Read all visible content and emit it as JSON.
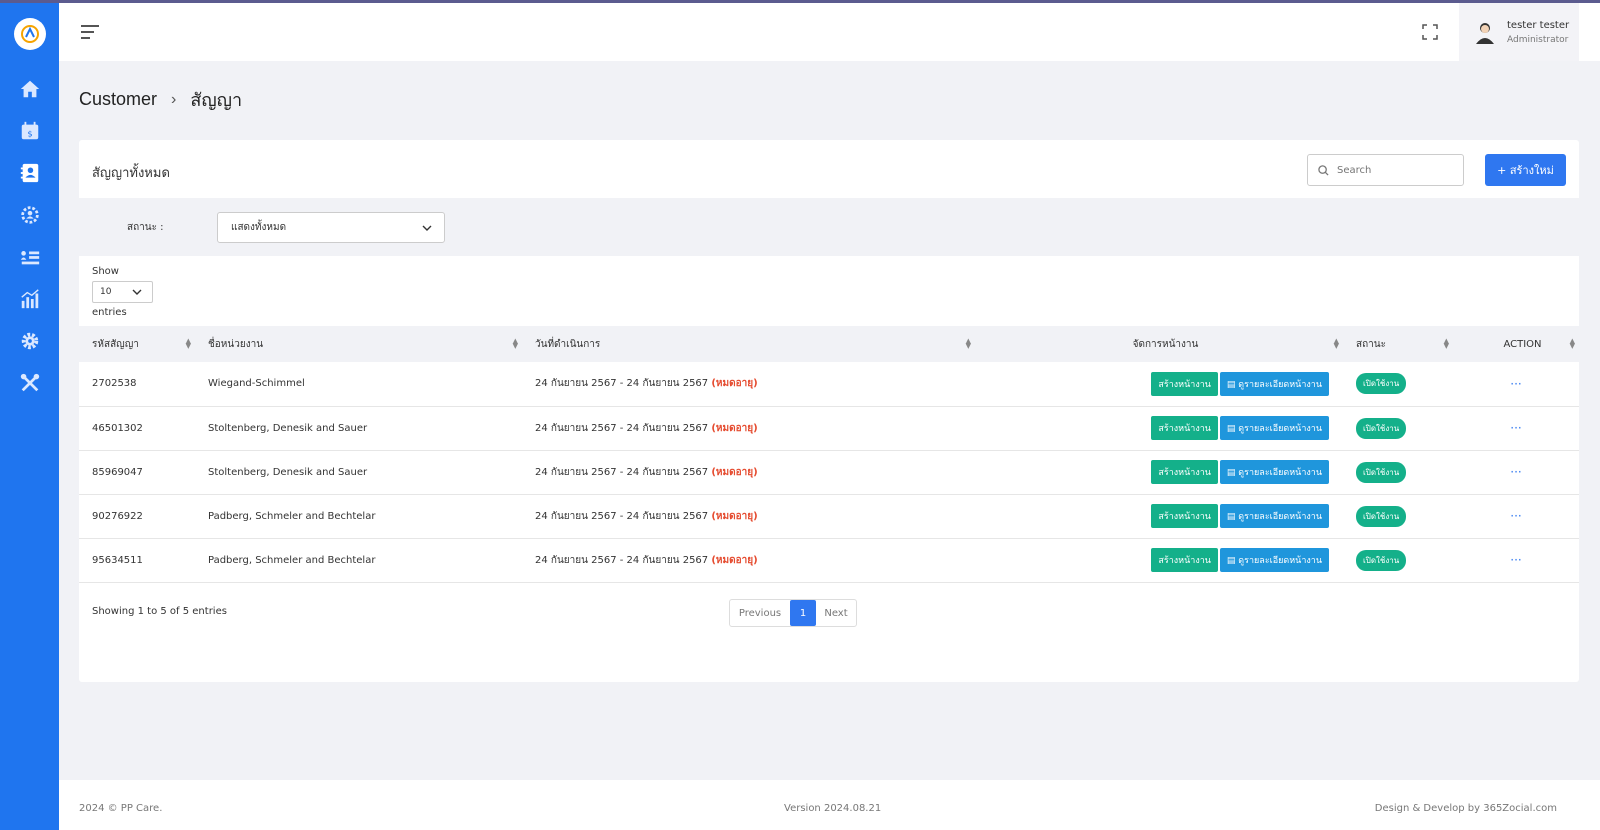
{
  "header": {
    "user_name": "tester tester",
    "user_role": "Administrator"
  },
  "breadcrumb": {
    "parent": "Customer",
    "current": "สัญญา"
  },
  "card": {
    "title": "สัญญาทั้งหมด",
    "search_placeholder": "Search",
    "create_label": "+ สร้างใหม่"
  },
  "filter": {
    "label": "สถานะ :",
    "selected": "แสดงทั้งหมด"
  },
  "length": {
    "show_label": "Show",
    "value": "10",
    "entries_label": "entries"
  },
  "table": {
    "headers": [
      "รหัสสัญญา",
      "ชื่อหน่วยงาน",
      "วันที่ดำเนินการ",
      "จัดการหน้างาน",
      "สถานะ",
      "ACTION"
    ],
    "expired_label": "(หมดอายุ)",
    "create_site_label": "สร้างหน้างาน",
    "view_site_label": "ดูรายละเอียดหน้างาน",
    "status_label": "เปิดใช้งาน",
    "more_label": "···",
    "rows": [
      {
        "id": "2702538",
        "org": "Wiegand-Schimmel",
        "date": "24 กันยายน 2567 - 24 กันยายน 2567"
      },
      {
        "id": "46501302",
        "org": "Stoltenberg, Denesik and Sauer",
        "date": "24 กันยายน 2567 - 24 กันยายน 2567"
      },
      {
        "id": "85969047",
        "org": "Stoltenberg, Denesik and Sauer",
        "date": "24 กันยายน 2567 - 24 กันยายน 2567"
      },
      {
        "id": "90276922",
        "org": "Padberg, Schmeler and Bechtelar",
        "date": "24 กันยายน 2567 - 24 กันยายน 2567"
      },
      {
        "id": "95634511",
        "org": "Padberg, Schmeler and Bechtelar",
        "date": "24 กันยายน 2567 - 24 กันยายน 2567"
      }
    ]
  },
  "pagination": {
    "info": "Showing 1 to 5 of 5 entries",
    "previous": "Previous",
    "current_page": "1",
    "next": "Next"
  },
  "footer": {
    "copyright": "2024 © PP Care.",
    "version": "Version 2024.08.21",
    "credit": "Design & Develop by 365Zocial.com"
  },
  "colors": {
    "sidebar": "#1f75ef",
    "primary": "#2f77f0",
    "success": "#14b08a",
    "info": "#1f96dc",
    "danger": "#e54b2f"
  },
  "icons": {
    "sidebar": [
      "home-icon",
      "calendar-money-icon",
      "contact-book-icon",
      "team-gear-icon",
      "list-icon",
      "chart-icon",
      "settings-icon",
      "tools-icon"
    ]
  }
}
